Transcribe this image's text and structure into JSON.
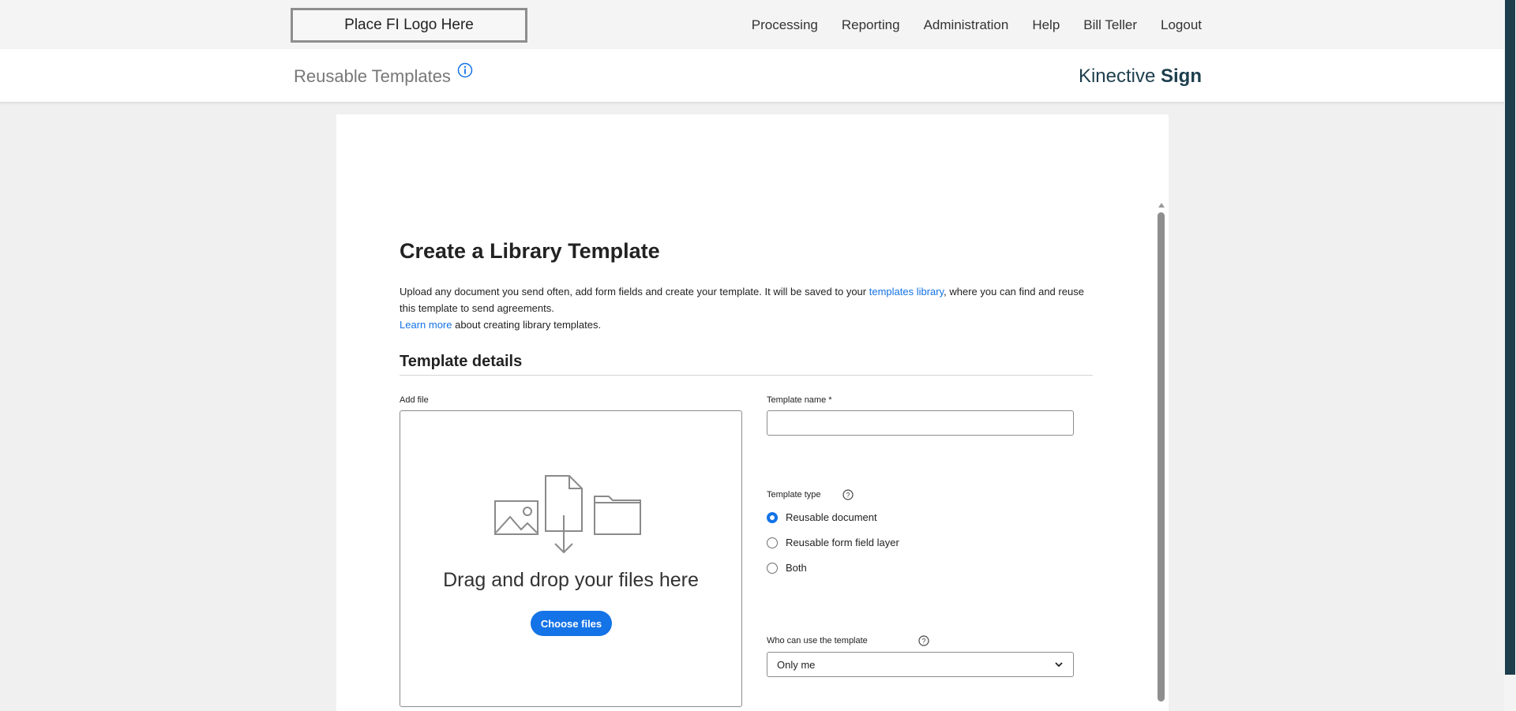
{
  "header": {
    "logo_text": "Place FI Logo Here",
    "nav": [
      "Processing",
      "Reporting",
      "Administration",
      "Help",
      "Bill Teller",
      "Logout"
    ]
  },
  "subheader": {
    "title": "Reusable Templates",
    "brand_light": "Kinective",
    "brand_bold": "Sign"
  },
  "form": {
    "title": "Create a Library Template",
    "desc_part1": "Upload any document you send often, add form fields and create your template. It will be saved to your ",
    "desc_link": "templates library",
    "desc_part2": ", where you can find and reuse this template to send agreements.",
    "learn_more": "Learn more",
    "learn_more_tail": " about creating library templates.",
    "section_title": "Template details",
    "add_file_label": "Add file",
    "drop_text": "Drag and drop your files here",
    "choose_files": "Choose files",
    "template_name_label": "Template name",
    "required_mark": "*",
    "template_name_value": "",
    "template_type_label": "Template type",
    "template_types": [
      {
        "label": "Reusable document",
        "checked": true
      },
      {
        "label": "Reusable form field layer",
        "checked": false
      },
      {
        "label": "Both",
        "checked": false
      }
    ],
    "who_label": "Who can use the template",
    "who_value": "Only me"
  },
  "colors": {
    "accent": "#1473e6",
    "brand": "#1d3e4d"
  }
}
